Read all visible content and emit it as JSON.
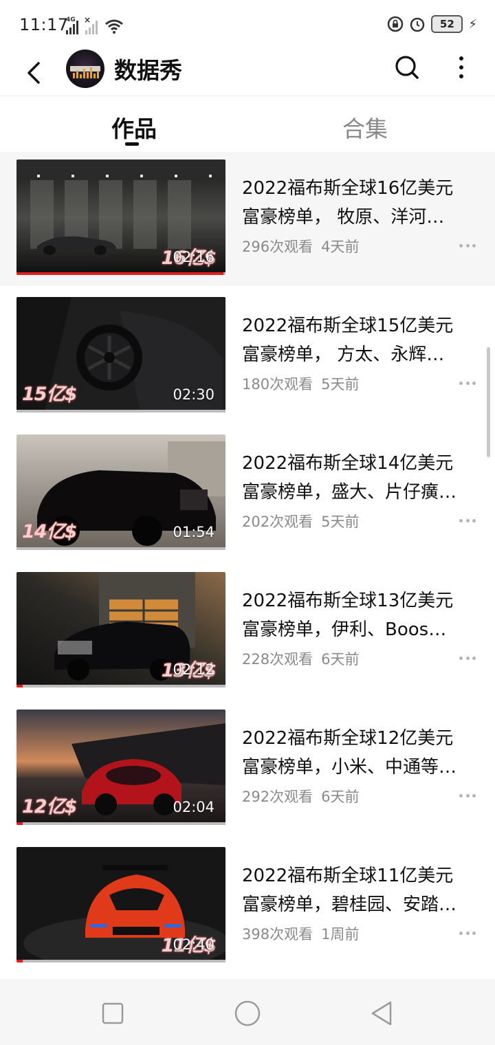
{
  "status_bar": {
    "time": "11:17",
    "battery": "52",
    "network": "4G"
  },
  "header": {
    "title": "数据秀"
  },
  "tabs": [
    {
      "label": "作品",
      "active": true
    },
    {
      "label": "合集",
      "active": false
    }
  ],
  "videos": [
    {
      "title_line1": "2022福布斯全球16亿美元",
      "title_line2": "富豪榜单， 牧原、洋河…",
      "views": "296次观看",
      "time": "4天前",
      "duration": "02:16",
      "amount": "16亿$",
      "amount_pos": "right",
      "progress": 0.99
    },
    {
      "title_line1": "2022福布斯全球15亿美元",
      "title_line2": "富豪榜单， 方太、永辉…",
      "views": "180次观看",
      "time": "5天前",
      "duration": "02:30",
      "amount": "15亿$",
      "amount_pos": "left",
      "progress": 0.0
    },
    {
      "title_line1": "2022福布斯全球14亿美元",
      "title_line2": "富豪榜单，盛大、片仔癀…",
      "views": "202次观看",
      "time": "5天前",
      "duration": "01:54",
      "amount": "14亿$",
      "amount_pos": "left",
      "progress": 0.0
    },
    {
      "title_line1": "2022福布斯全球13亿美元",
      "title_line2": "富豪榜单，伊利、Boos…",
      "views": "228次观看",
      "time": "6天前",
      "duration": "02:12",
      "amount": "13亿$",
      "amount_pos": "right",
      "progress": 0.03
    },
    {
      "title_line1": "2022福布斯全球12亿美元",
      "title_line2": "富豪榜单，小米、中通等…",
      "views": "292次观看",
      "time": "6天前",
      "duration": "02:04",
      "amount": "12亿$",
      "amount_pos": "left",
      "progress": 0.03
    },
    {
      "title_line1": "2022福布斯全球11亿美元",
      "title_line2": "富豪榜单，碧桂园、安踏…",
      "views": "398次观看",
      "time": "1周前",
      "duration": "02:40",
      "amount": "11亿$",
      "amount_pos": "right",
      "progress": 0.03
    }
  ],
  "colors": {
    "accent": "#e02020",
    "meta_text": "#8a8a8a",
    "amount_text": "#f4d0cf"
  },
  "icons": {
    "back": "chevron-left-icon",
    "search": "search-icon",
    "more": "more-vertical-icon",
    "item_more": "more-horizontal-icon",
    "nav_recent": "square-icon",
    "nav_home": "circle-icon",
    "nav_back": "triangle-back-icon"
  }
}
